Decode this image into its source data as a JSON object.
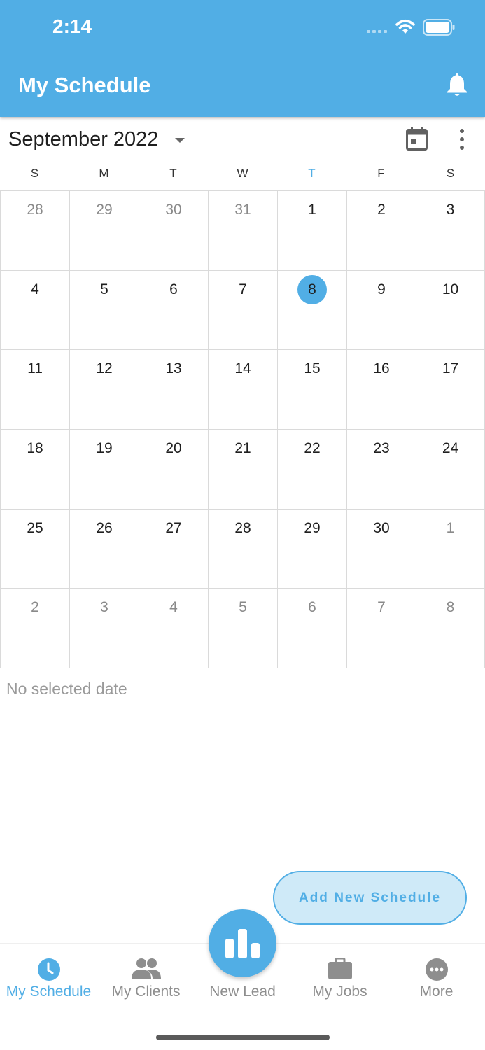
{
  "status_bar": {
    "time": "2:14"
  },
  "header": {
    "title": "My Schedule"
  },
  "calendar": {
    "month_label": "September 2022",
    "weekdays": [
      "S",
      "M",
      "T",
      "W",
      "T",
      "F",
      "S"
    ],
    "today_weekday_index": 4,
    "weeks": [
      [
        {
          "d": "28",
          "out": true
        },
        {
          "d": "29",
          "out": true
        },
        {
          "d": "30",
          "out": true
        },
        {
          "d": "31",
          "out": true
        },
        {
          "d": "1"
        },
        {
          "d": "2"
        },
        {
          "d": "3"
        }
      ],
      [
        {
          "d": "4"
        },
        {
          "d": "5"
        },
        {
          "d": "6"
        },
        {
          "d": "7"
        },
        {
          "d": "8",
          "selected": true
        },
        {
          "d": "9"
        },
        {
          "d": "10"
        }
      ],
      [
        {
          "d": "11"
        },
        {
          "d": "12"
        },
        {
          "d": "13"
        },
        {
          "d": "14"
        },
        {
          "d": "15"
        },
        {
          "d": "16"
        },
        {
          "d": "17"
        }
      ],
      [
        {
          "d": "18"
        },
        {
          "d": "19"
        },
        {
          "d": "20"
        },
        {
          "d": "21"
        },
        {
          "d": "22"
        },
        {
          "d": "23"
        },
        {
          "d": "24"
        }
      ],
      [
        {
          "d": "25"
        },
        {
          "d": "26"
        },
        {
          "d": "27"
        },
        {
          "d": "28"
        },
        {
          "d": "29"
        },
        {
          "d": "30"
        },
        {
          "d": "1",
          "out": true
        }
      ],
      [
        {
          "d": "2",
          "out": true
        },
        {
          "d": "3",
          "out": true
        },
        {
          "d": "4",
          "out": true
        },
        {
          "d": "5",
          "out": true
        },
        {
          "d": "6",
          "out": true
        },
        {
          "d": "7",
          "out": true
        },
        {
          "d": "8",
          "out": true
        }
      ]
    ]
  },
  "empty_state": {
    "text": "No selected date"
  },
  "add_button": {
    "label": "Add New Schedule"
  },
  "tabs": [
    {
      "label": "My Schedule",
      "icon": "clock-icon",
      "active": true
    },
    {
      "label": "My Clients",
      "icon": "people-icon"
    },
    {
      "label": "New Lead",
      "icon": "bar-chart-icon"
    },
    {
      "label": "My Jobs",
      "icon": "briefcase-icon"
    },
    {
      "label": "More",
      "icon": "more-icon"
    }
  ],
  "colors": {
    "accent": "#51aee5",
    "accent_light": "#cfeaf8",
    "text": "#1f1f1f",
    "muted": "#8a8a8a"
  }
}
